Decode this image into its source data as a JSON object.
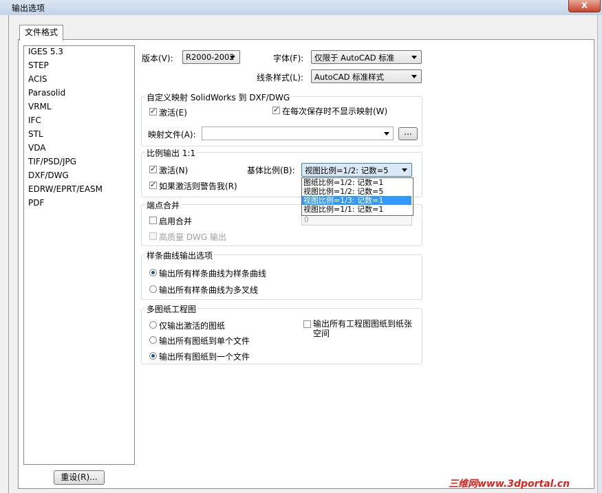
{
  "window": {
    "title": "输出选项",
    "close_label": "X"
  },
  "tab": {
    "label": "文件格式"
  },
  "formats": [
    "IGES 5.3",
    "STEP",
    "ACIS",
    "Parasolid",
    "VRML",
    "IFC",
    "STL",
    "VDA",
    "TIF/PSD/JPG",
    "DXF/DWG",
    "EDRW/EPRT/EASM",
    "PDF"
  ],
  "reset_button": "重设(R)...",
  "version": {
    "label": "版本(V):",
    "value": "R2000-2002"
  },
  "font": {
    "label": "字体(F):",
    "value": "仅限于 AutoCAD 标准"
  },
  "linestyle": {
    "label": "线条样式(L):",
    "value": "AutoCAD 标准样式"
  },
  "mapping": {
    "legend": "自定义映射 SolidWorks 到 DXF/DWG",
    "activate": "激活(E)",
    "no_show": "在每次保存时不显示映射(W)",
    "file_label": "映射文件(A):",
    "browse": "..."
  },
  "scale": {
    "legend": "比例输出 1:1",
    "activate": "激活(N)",
    "warn": "如果激活则警告我(R)",
    "base_label": "基体比例(B):",
    "base_value": "视图比例=1/2: 记数=5",
    "options": [
      "图纸比例=1/2: 记数=1",
      "视图比例=1/2: 记数=5",
      "视图比例=1/3: 记数=1",
      "视图比例=1/1: 记数=1"
    ],
    "selected_index": 2
  },
  "endpoint": {
    "legend": "端点合并",
    "enable": "启用合并",
    "high_quality": "高质量 DWG 输出",
    "value": "0"
  },
  "spline": {
    "legend": "样条曲线输出选项",
    "opt1": "输出所有样条曲线为样条曲线",
    "opt2": "输出所有样条曲线为多叉线"
  },
  "multisheet": {
    "legend": "多图纸工程图",
    "opt1": "仅输出激活的图纸",
    "opt2": "输出所有图纸到单个文件",
    "opt3": "输出所有图纸到一个文件",
    "paper_space": "输出所有工程图图纸到纸张空间"
  },
  "watermark": "三维网www.3dportal.cn"
}
